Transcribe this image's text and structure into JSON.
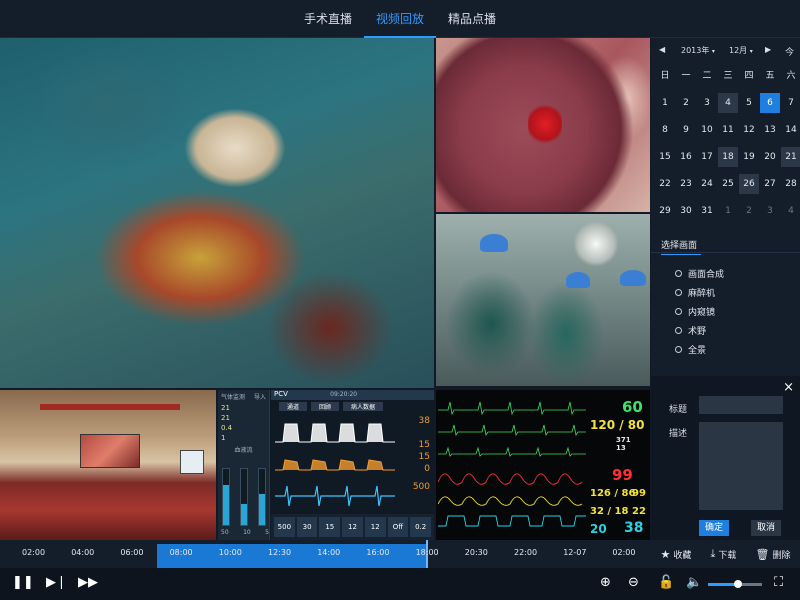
{
  "tabs": [
    {
      "label": "手术直播"
    },
    {
      "label": "视频回放"
    },
    {
      "label": "精品点播"
    }
  ],
  "calendar": {
    "year": "2013年",
    "month": "12月",
    "today_label": "今",
    "weekdays": [
      "日",
      "一",
      "二",
      "三",
      "四",
      "五",
      "六"
    ],
    "days": [
      [
        "1",
        "2",
        "3",
        "4",
        "5",
        "6",
        "7"
      ],
      [
        "8",
        "9",
        "10",
        "11",
        "12",
        "13",
        "14"
      ],
      [
        "15",
        "16",
        "17",
        "18",
        "19",
        "20",
        "21"
      ],
      [
        "22",
        "23",
        "24",
        "25",
        "26",
        "27",
        "28"
      ],
      [
        "29",
        "30",
        "31",
        "1",
        "2",
        "3",
        "4"
      ]
    ],
    "selected_day": "6"
  },
  "picture_select": {
    "title": "选择画面",
    "options": [
      "画面合成",
      "麻醉机",
      "内窥镜",
      "术野",
      "全景"
    ]
  },
  "form": {
    "close": "×",
    "title_label": "标题",
    "desc_label": "描述",
    "title_value": "",
    "desc_value": "",
    "confirm": "确定",
    "cancel": "取消"
  },
  "actions": {
    "favorite": "收藏",
    "download": "下载",
    "delete": "删除"
  },
  "timeline": {
    "ticks": [
      "02:00",
      "04:00",
      "06:00",
      "08:00",
      "10:00",
      "12:30",
      "14:00",
      "16:00",
      "18:00",
      "20:30",
      "22:00",
      "12-07",
      "02:00"
    ]
  },
  "volume": {
    "level": 0.55
  },
  "anesthesia": {
    "left_header": "气体监测",
    "left_header_right": "导入",
    "left_rows": [
      "21",
      "21",
      "0.4",
      "1"
    ],
    "left_section": "血液流",
    "bar_levels": [
      0.72,
      0.38,
      0.55
    ],
    "bar_labels": [
      "50",
      "10",
      "5"
    ],
    "title": "PCV",
    "time": "09:20:20",
    "panel_tabs": [
      "通道",
      "回顾",
      "病人数据"
    ],
    "values": [
      "38",
      "15",
      "15",
      "0",
      "500"
    ],
    "bottom": [
      "500",
      "30",
      "15",
      "12",
      "12",
      "Off",
      "0.2"
    ]
  },
  "monitor": {
    "hr": "60",
    "bp": "120 / 80",
    "bp_small": "371",
    "bp_small2": "13",
    "spo2": "99",
    "nibp": "126 / 86",
    "nibp_map": "99",
    "etco2": "32 / 18",
    "etco2_rr": "22",
    "temp": "20",
    "temp2": "38"
  }
}
